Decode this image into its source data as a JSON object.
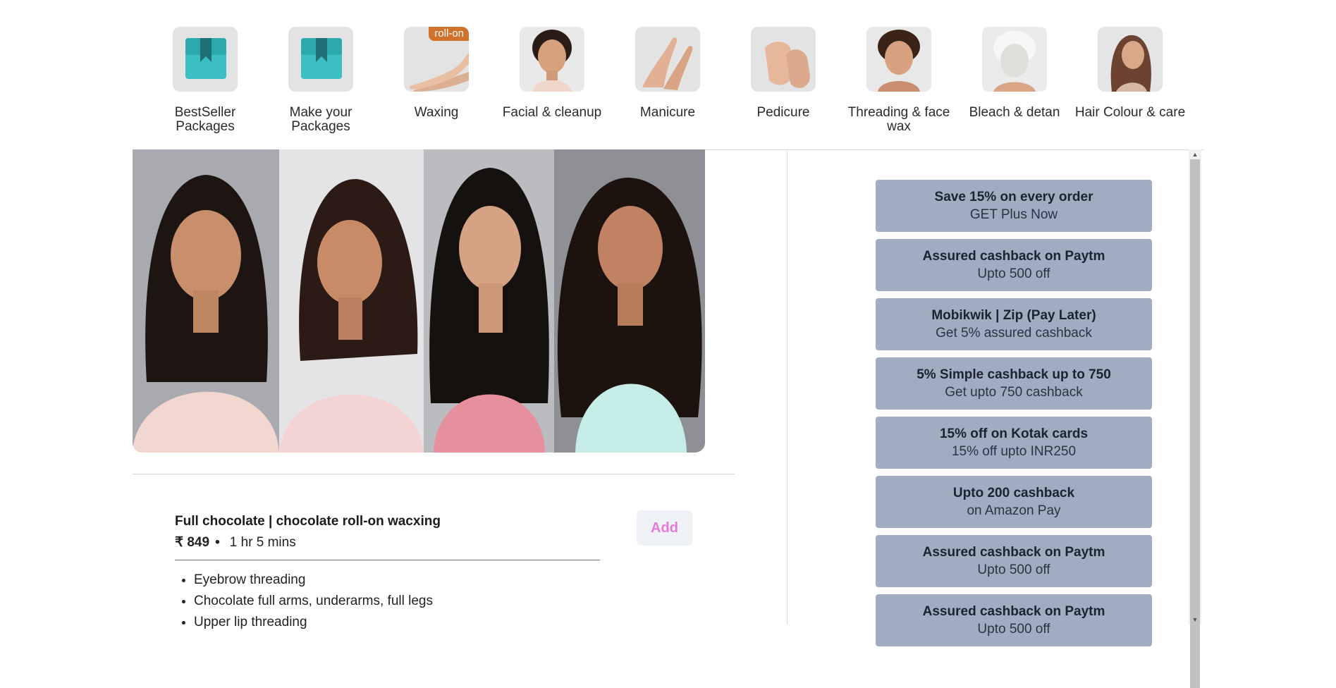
{
  "categories": [
    {
      "label": "BestSeller Packages",
      "icon": "bookmark-box-icon"
    },
    {
      "label": "Make your Packages",
      "icon": "bookmark-box-icon"
    },
    {
      "label": "Waxing",
      "tag": "roll-on",
      "icon": "legs-photo"
    },
    {
      "label": "Facial & cleanup",
      "icon": "face-photo"
    },
    {
      "label": "Manicure",
      "icon": "hands-photo"
    },
    {
      "label": "Pedicure",
      "icon": "feet-photo"
    },
    {
      "label": "Threading & face wax",
      "icon": "threading-photo"
    },
    {
      "label": "Bleach & detan",
      "icon": "face-mask-photo"
    },
    {
      "label": "Hair Colour & care",
      "icon": "hair-photo"
    }
  ],
  "service": {
    "title": "Full chocolate | chocolate roll-on wacxing",
    "price": "₹ 849",
    "bullet": "•",
    "duration": "1 hr 5 mins",
    "add_label": "Add",
    "items": [
      "Eyebrow threading",
      "Chocolate full arms, underarms, full legs",
      "Upper lip threading"
    ]
  },
  "offers": [
    {
      "title": "Save 15% on every order",
      "subtitle": "GET Plus Now"
    },
    {
      "title": "Assured cashback on Paytm",
      "subtitle": "Upto 500 off"
    },
    {
      "title": "Mobikwik | Zip (Pay Later)",
      "subtitle": "Get 5% assured cashback"
    },
    {
      "title": "5% Simple cashback up to 750",
      "subtitle": "Get upto 750 cashback"
    },
    {
      "title": "15% off on Kotak cards",
      "subtitle": "15% off upto INR250"
    },
    {
      "title": "Upto 200 cashback",
      "subtitle": "on Amazon Pay"
    },
    {
      "title": "Assured cashback on Paytm",
      "subtitle": "Upto 500 off"
    },
    {
      "title": "Assured cashback on Paytm",
      "subtitle": "Upto 500 off"
    }
  ],
  "colors": {
    "offer_bg": "#a0adc1",
    "add_text": "#e879d9",
    "tag_bg": "#d0722c",
    "package_icon": "#3bbfc2"
  }
}
